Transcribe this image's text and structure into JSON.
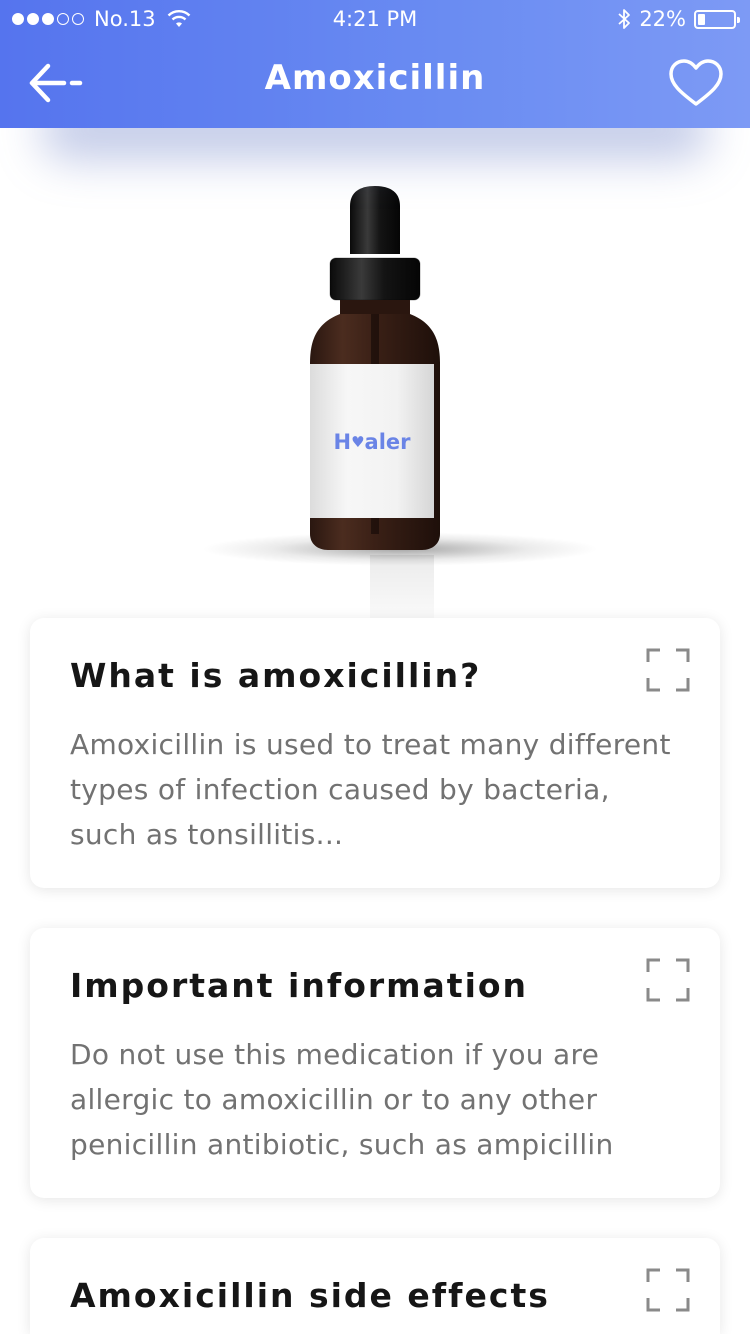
{
  "status_bar": {
    "carrier": "No.13",
    "time": "4:21 PM",
    "battery_text": "22%",
    "battery_level": 0.22
  },
  "header": {
    "title": "Amoxicillin",
    "back_icon": "back-arrow-icon",
    "favorite_icon": "heart-outline-icon",
    "gradient_start": "#5574ee",
    "gradient_end": "#7d9af5"
  },
  "product": {
    "brand_prefix": "H",
    "brand_suffix": "aler",
    "brand_color": "#6a84e6"
  },
  "cards": [
    {
      "title": "What is amoxicillin?",
      "text": "Amoxicillin is used to treat many different types of infection caused by bacteria, such as tonsillitis..."
    },
    {
      "title": "Important information",
      "text": "Do not use this medication if you are allergic to amoxicillin or to any other penicillin antibiotic, such as ampicillin"
    },
    {
      "title": "Amoxicillin side effects",
      "text": ""
    }
  ]
}
